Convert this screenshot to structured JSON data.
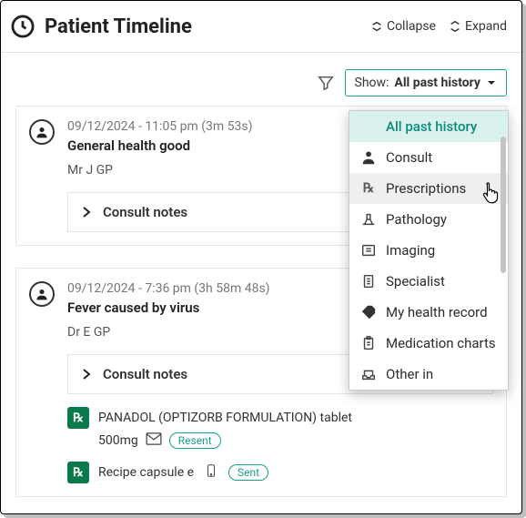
{
  "header": {
    "title": "Patient Timeline",
    "collapse": "Collapse",
    "expand": "Expand"
  },
  "filter": {
    "show_prefix": "Show:",
    "show_value": "All past history"
  },
  "dropdown": {
    "items": [
      {
        "icon": "",
        "label": "All past history",
        "selected": true
      },
      {
        "icon": "person",
        "label": "Consult"
      },
      {
        "icon": "rx",
        "label": "Prescriptions",
        "hover": true
      },
      {
        "icon": "flask",
        "label": "Pathology"
      },
      {
        "icon": "xray",
        "label": "Imaging"
      },
      {
        "icon": "doc",
        "label": "Specialist"
      },
      {
        "icon": "tag",
        "label": "My health record"
      },
      {
        "icon": "clipboard",
        "label": "Medication charts"
      },
      {
        "icon": "tray",
        "label": "Other in"
      }
    ]
  },
  "entries": [
    {
      "when": "09/12/2024 - 11:05 pm (3m 53s)",
      "subject": "General health good",
      "who": "Mr J GP",
      "notes_label": "Consult notes",
      "rx": []
    },
    {
      "when": "09/12/2024 - 7:36 pm (3h 58m 48s)",
      "subject": "Fever caused by virus",
      "who": "Dr E GP",
      "notes_label": "Consult notes",
      "rx": [
        {
          "name": "PANADOL (OPTIZORB FORMULATION) tablet",
          "dose": "500mg",
          "channel": "mail",
          "badge": "Resent"
        },
        {
          "name": "Recipe capsule e",
          "dose": "",
          "channel": "phone",
          "badge": "Sent"
        }
      ]
    }
  ]
}
